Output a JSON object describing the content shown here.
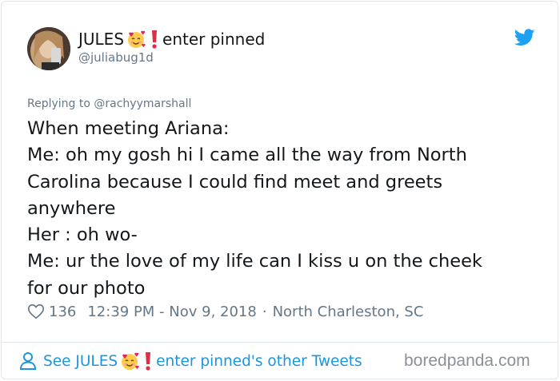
{
  "author": {
    "display_name_prefix": "JULES",
    "display_name_suffix": "enter pinned",
    "username": "@juliabug1d",
    "name_emojis": [
      "smiling-face-with-hearts-icon",
      "red-exclamation-icon"
    ]
  },
  "reply": {
    "context": "Replying to @rachyymarshall"
  },
  "tweet": {
    "lines": [
      "When meeting Ariana:",
      "Me: oh my gosh hi I came all the way from North",
      "Carolina because I could find meet and greets",
      "anywhere",
      "Her : oh wo-",
      "Me: ur the love of my life can I kiss u on the cheek",
      "for our photo"
    ]
  },
  "meta": {
    "likes": "136",
    "timestamp": "12:39 PM - Nov 9, 2018",
    "separator": "·",
    "location": "North Charleston, SC"
  },
  "footer": {
    "see_prefix": "See JULES",
    "see_suffix": "enter pinned's other Tweets"
  },
  "watermark": "boredpanda.com",
  "colors": {
    "link_blue": "#1b95e0",
    "twitter_blue": "#1da1f2",
    "muted_gray": "#657786",
    "text": "#14171a"
  }
}
